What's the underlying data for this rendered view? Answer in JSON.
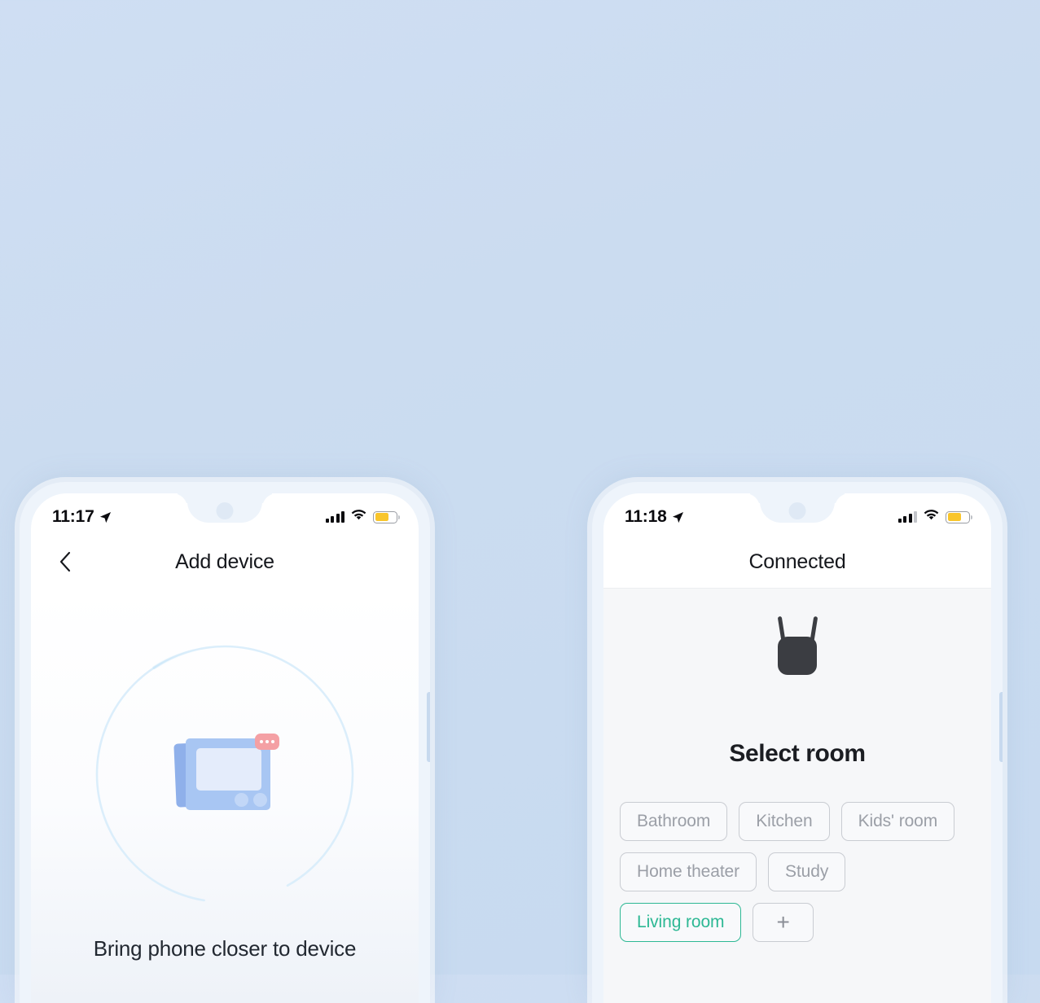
{
  "theme": {
    "background": "#cbdcf0",
    "accent_blue": "#3b9fe0",
    "accent_green": "#2db894",
    "battery_yellow": "#f9c52b",
    "device_dark": "#3b3d42",
    "illustration_blue": "#a8c6f3",
    "badge_pink": "#f4a0a4"
  },
  "left_phone": {
    "status_bar": {
      "time": "11:17",
      "location_icon": "location-arrow-icon",
      "signal_icon": "cellular-signal-icon",
      "signal_bars_active": 4,
      "wifi_icon": "wifi-icon",
      "battery_icon": "battery-low-power-icon",
      "battery_level": 66
    },
    "header": {
      "back_icon": "chevron-left-icon",
      "title": "Add device"
    },
    "content": {
      "progress_ring_icon": "scanning-progress-ring",
      "device_illustration_icon": "smart-display-device-icon",
      "badge_icon": "three-dots-badge-icon",
      "hint_text": "Bring phone closer to device"
    }
  },
  "right_phone": {
    "status_bar": {
      "time": "11:18",
      "location_icon": "location-arrow-icon",
      "signal_icon": "cellular-signal-icon",
      "signal_bars_active": 3,
      "wifi_icon": "wifi-icon",
      "battery_icon": "battery-low-power-icon",
      "battery_level": 66
    },
    "header": {
      "title": "Connected"
    },
    "content": {
      "device_illustration_icon": "wifi-range-extender-icon",
      "section_title": "Select room",
      "rooms": [
        {
          "label": "Bathroom",
          "selected": false
        },
        {
          "label": "Kitchen",
          "selected": false
        },
        {
          "label": "Kids' room",
          "selected": false
        },
        {
          "label": "Home theater",
          "selected": false
        },
        {
          "label": "Study",
          "selected": false
        },
        {
          "label": "Living room",
          "selected": true
        }
      ],
      "add_room_label": "+"
    }
  }
}
